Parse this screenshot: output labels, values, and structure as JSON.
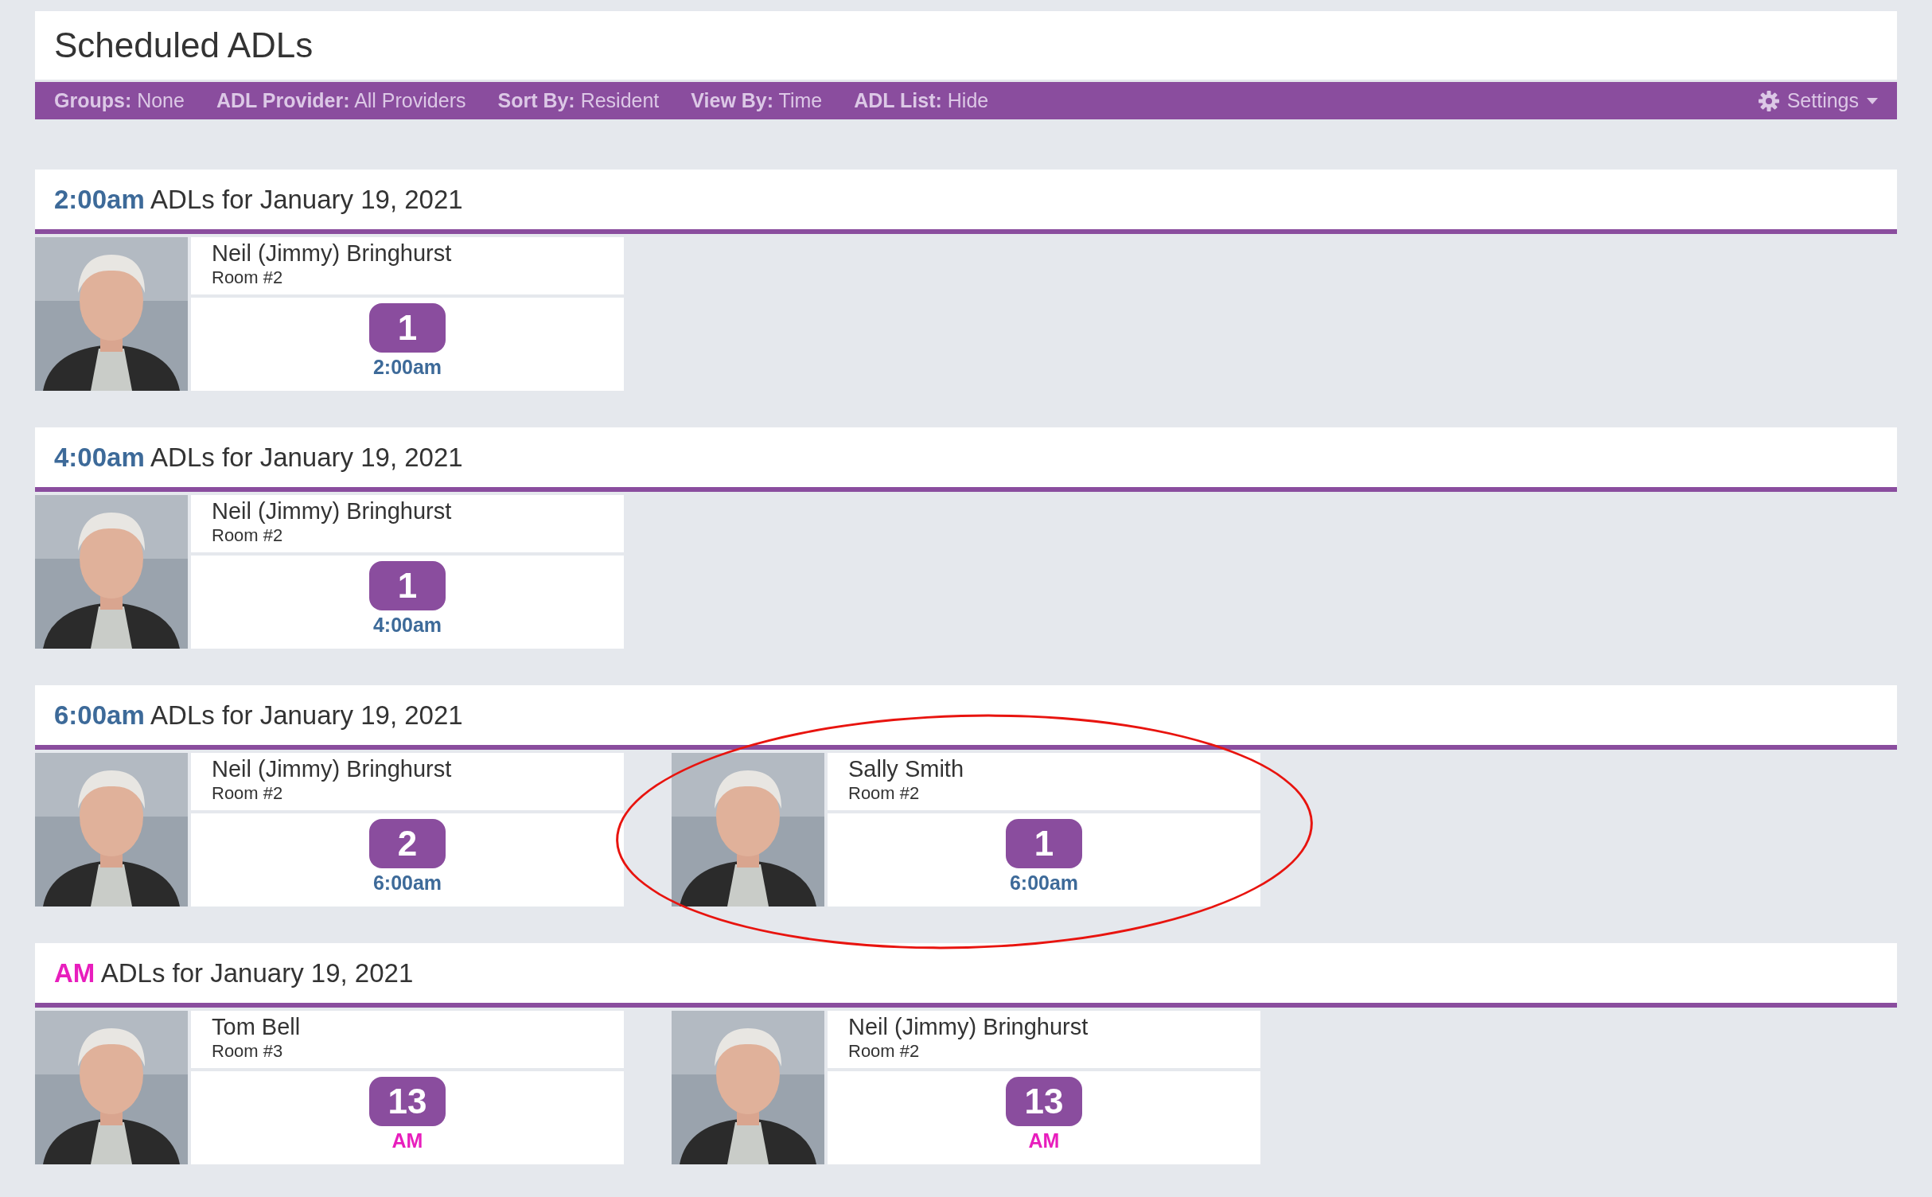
{
  "title": "Scheduled ADLs",
  "filters": [
    {
      "label": "Groups:",
      "value": "None"
    },
    {
      "label": "ADL Provider:",
      "value": "All Providers"
    },
    {
      "label": "Sort By:",
      "value": "Resident"
    },
    {
      "label": "View By:",
      "value": "Time"
    },
    {
      "label": "ADL List:",
      "value": "Hide"
    }
  ],
  "settings": "Settings",
  "sections": [
    {
      "time": "2:00am",
      "color": "#3d6a99",
      "heading": "ADLs for January 19, 2021",
      "residents": [
        {
          "name": "Neil (Jimmy) Bringhurst",
          "room": "Room #2",
          "count": "1",
          "time": "2:00am",
          "circled": false
        }
      ]
    },
    {
      "time": "4:00am",
      "color": "#3d6a99",
      "heading": "ADLs for January 19, 2021",
      "residents": [
        {
          "name": "Neil (Jimmy) Bringhurst",
          "room": "Room #2",
          "count": "1",
          "time": "4:00am",
          "circled": false
        }
      ]
    },
    {
      "time": "6:00am",
      "color": "#3d6a99",
      "heading": "ADLs for January 19, 2021",
      "residents": [
        {
          "name": "Neil (Jimmy) Bringhurst",
          "room": "Room #2",
          "count": "2",
          "time": "6:00am",
          "circled": false
        },
        {
          "name": "Sally Smith",
          "room": "Room #2",
          "count": "1",
          "time": "6:00am",
          "circled": true
        }
      ]
    },
    {
      "time": "AM",
      "color": "#e81ebd",
      "heading": "ADLs for January 19, 2021",
      "residents": [
        {
          "name": "Tom Bell",
          "room": "Room #3",
          "count": "13",
          "time": "AM",
          "circled": false
        },
        {
          "name": "Neil (Jimmy) Bringhurst",
          "room": "Room #2",
          "count": "13",
          "time": "AM",
          "circled": false
        }
      ]
    }
  ]
}
